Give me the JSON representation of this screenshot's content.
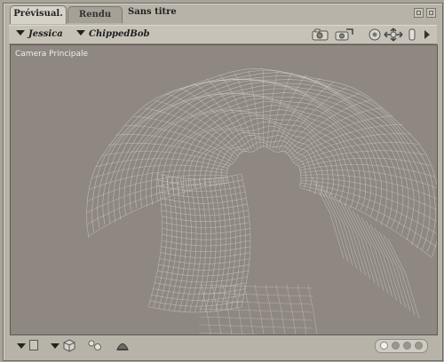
{
  "tabs": [
    {
      "label": "Prévisual.",
      "active": true
    },
    {
      "label": "Rendu",
      "active": false
    }
  ],
  "document_title": "Sans titre",
  "toolbar": {
    "figure_menu": "Jessica",
    "actor_menu": "ChippedBob",
    "icons": [
      "camera-icon",
      "camera-move-icon",
      "render-settings-icon",
      "translate-icon",
      "scale-icon",
      "more-arrow-icon"
    ]
  },
  "viewport": {
    "camera_label": "Camera Principale"
  },
  "bottombar": {
    "icons": [
      "menu-caret-icon",
      "frame-icon",
      "cube-display-icon",
      "spheres-icon",
      "light-icon"
    ],
    "view_dots": 4
  },
  "colors": {
    "viewport_bg": "#8e8880",
    "mesh_line": "#e6e3dc",
    "panel_bg": "#b8b3a8"
  }
}
